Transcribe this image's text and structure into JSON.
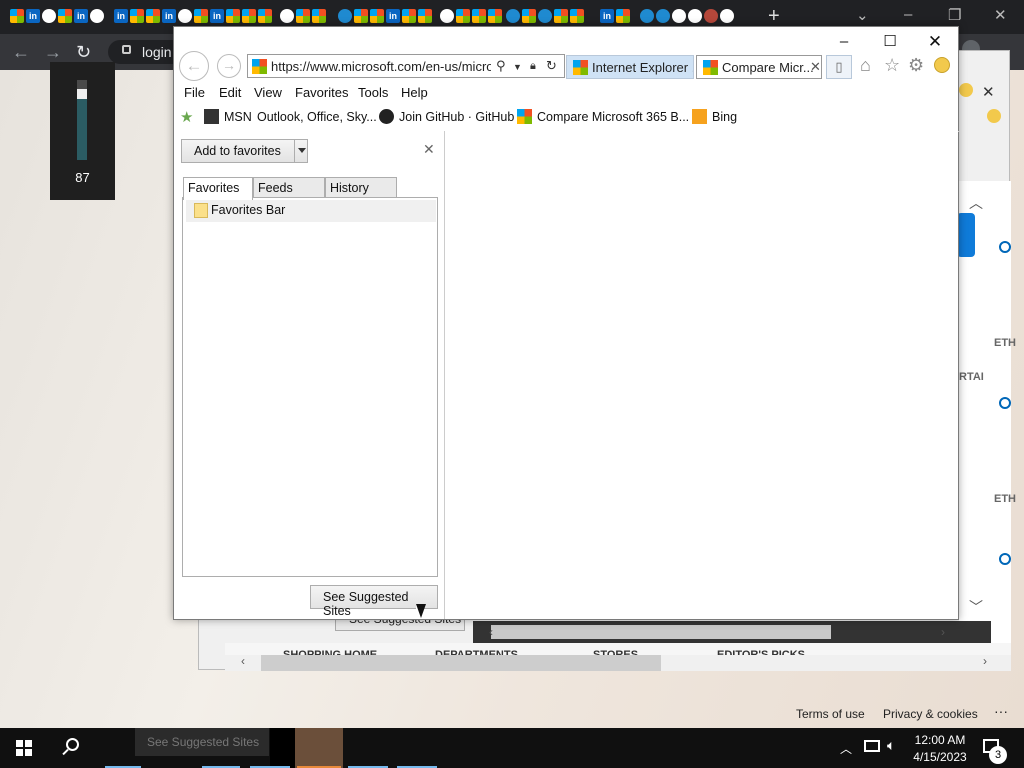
{
  "background_browser": {
    "address_text": "login",
    "volume_flyout": {
      "value": "87",
      "level_percent": 87
    }
  },
  "background_page": {
    "suggest_button": "See Suggested Sites",
    "edge_labels": [
      "ETH",
      "RTAI",
      "ETH"
    ],
    "nav_items": [
      "SHOPPING HOME",
      "DEPARTMENTS",
      "STORES",
      "EDITOR'S PICKS"
    ],
    "footer": {
      "terms": "Terms of use",
      "privacy": "Privacy & cookies",
      "more": "···"
    }
  },
  "ie": {
    "address": {
      "url": "https://www.microsoft.com/en-us/micro"
    },
    "tabs": [
      {
        "label": "Internet Explorer ...",
        "active": false
      },
      {
        "label": "Compare Micr...",
        "active": true
      }
    ],
    "menu": [
      "File",
      "Edit",
      "View",
      "Favorites",
      "Tools",
      "Help"
    ],
    "favorites_bar": [
      {
        "label": "MSN",
        "icon": "msn-icon"
      },
      {
        "label": "Outlook, Office, Sky...",
        "icon": "none"
      },
      {
        "label": "Join GitHub · GitHub",
        "icon": "github-icon"
      },
      {
        "label": "Compare Microsoft 365 B...",
        "icon": "microsoft-icon"
      },
      {
        "label": "Bing",
        "icon": "bing-icon"
      }
    ],
    "favorites_center": {
      "add_button": "Add to favorites",
      "tabs": [
        "Favorites",
        "Feeds",
        "History"
      ],
      "active_tab": "Favorites",
      "items": [
        {
          "label": "Favorites Bar",
          "icon": "folder-icon"
        }
      ],
      "suggest_button": "See Suggested Sites"
    }
  },
  "taskbar": {
    "tooltip": "See Suggested Sites",
    "time": "12:00 AM",
    "date": "4/15/2023",
    "notification_count": "3"
  }
}
